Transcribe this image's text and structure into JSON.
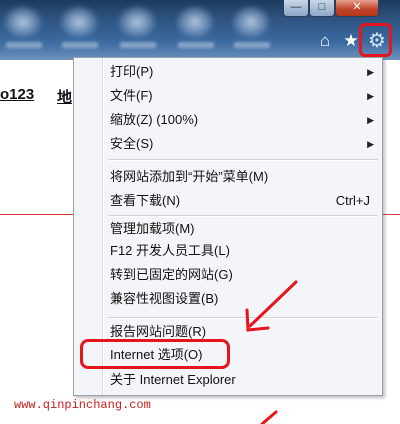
{
  "page": {
    "left_text": "o123",
    "right_text": "地",
    "watermark": "www.qinpinchang.com"
  },
  "toolbar": {
    "home_icon": "home-icon",
    "favorites_icon": "star-icon",
    "tools_icon": "gear-icon"
  },
  "menu": {
    "items": [
      {
        "label": "打印(P)",
        "submenu": true
      },
      {
        "label": "文件(F)",
        "submenu": true
      },
      {
        "label": "缩放(Z) (100%)",
        "submenu": true
      },
      {
        "label": "安全(S)",
        "submenu": true
      },
      {
        "label": "将网站添加到“开始”菜单(M)"
      },
      {
        "label": "查看下载(N)",
        "shortcut": "Ctrl+J"
      },
      {
        "label": "管理加载项(M)"
      },
      {
        "label": "F12 开发人员工具(L)"
      },
      {
        "label": "转到已固定的网站(G)"
      },
      {
        "label": "兼容性视图设置(B)"
      },
      {
        "label": "报告网站问题(R)"
      },
      {
        "label": "Internet 选项(O)",
        "highlighted": true
      },
      {
        "label": "关于 Internet Explorer"
      }
    ]
  },
  "colors": {
    "highlight": "#e8141c",
    "menu_bg": "#f3f5f8",
    "titlebar": "#2f5684"
  }
}
